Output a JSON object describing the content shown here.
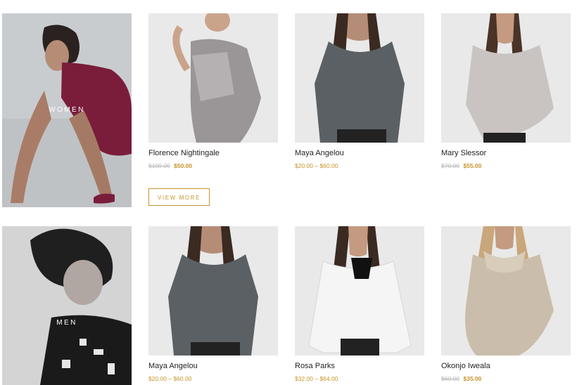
{
  "categories": [
    {
      "label": "WOMEN"
    },
    {
      "label": "MEN"
    }
  ],
  "rows": [
    {
      "products": [
        {
          "name": "Florence Nightingale",
          "old_price": "$100.00",
          "price": "$50.00"
        },
        {
          "name": "Maya Angelou",
          "price_range": "$20.00 – $60.00"
        },
        {
          "name": "Mary Slessor",
          "old_price": "$70.00",
          "price": "$55.00"
        }
      ],
      "view_more": "VIEW MORE"
    },
    {
      "products": [
        {
          "name": "Maya Angelou",
          "price_range": "$20.00 – $60.00"
        },
        {
          "name": "Rosa Parks",
          "price_range": "$32.00 – $64.00"
        },
        {
          "name": "Okonjo Iweala",
          "old_price": "$60.00",
          "price": "$35.00"
        }
      ]
    }
  ],
  "colors": {
    "accent": "#c7942a",
    "strikethrough": "#b5b5b5",
    "photo_bg": "#e8e8e8"
  }
}
